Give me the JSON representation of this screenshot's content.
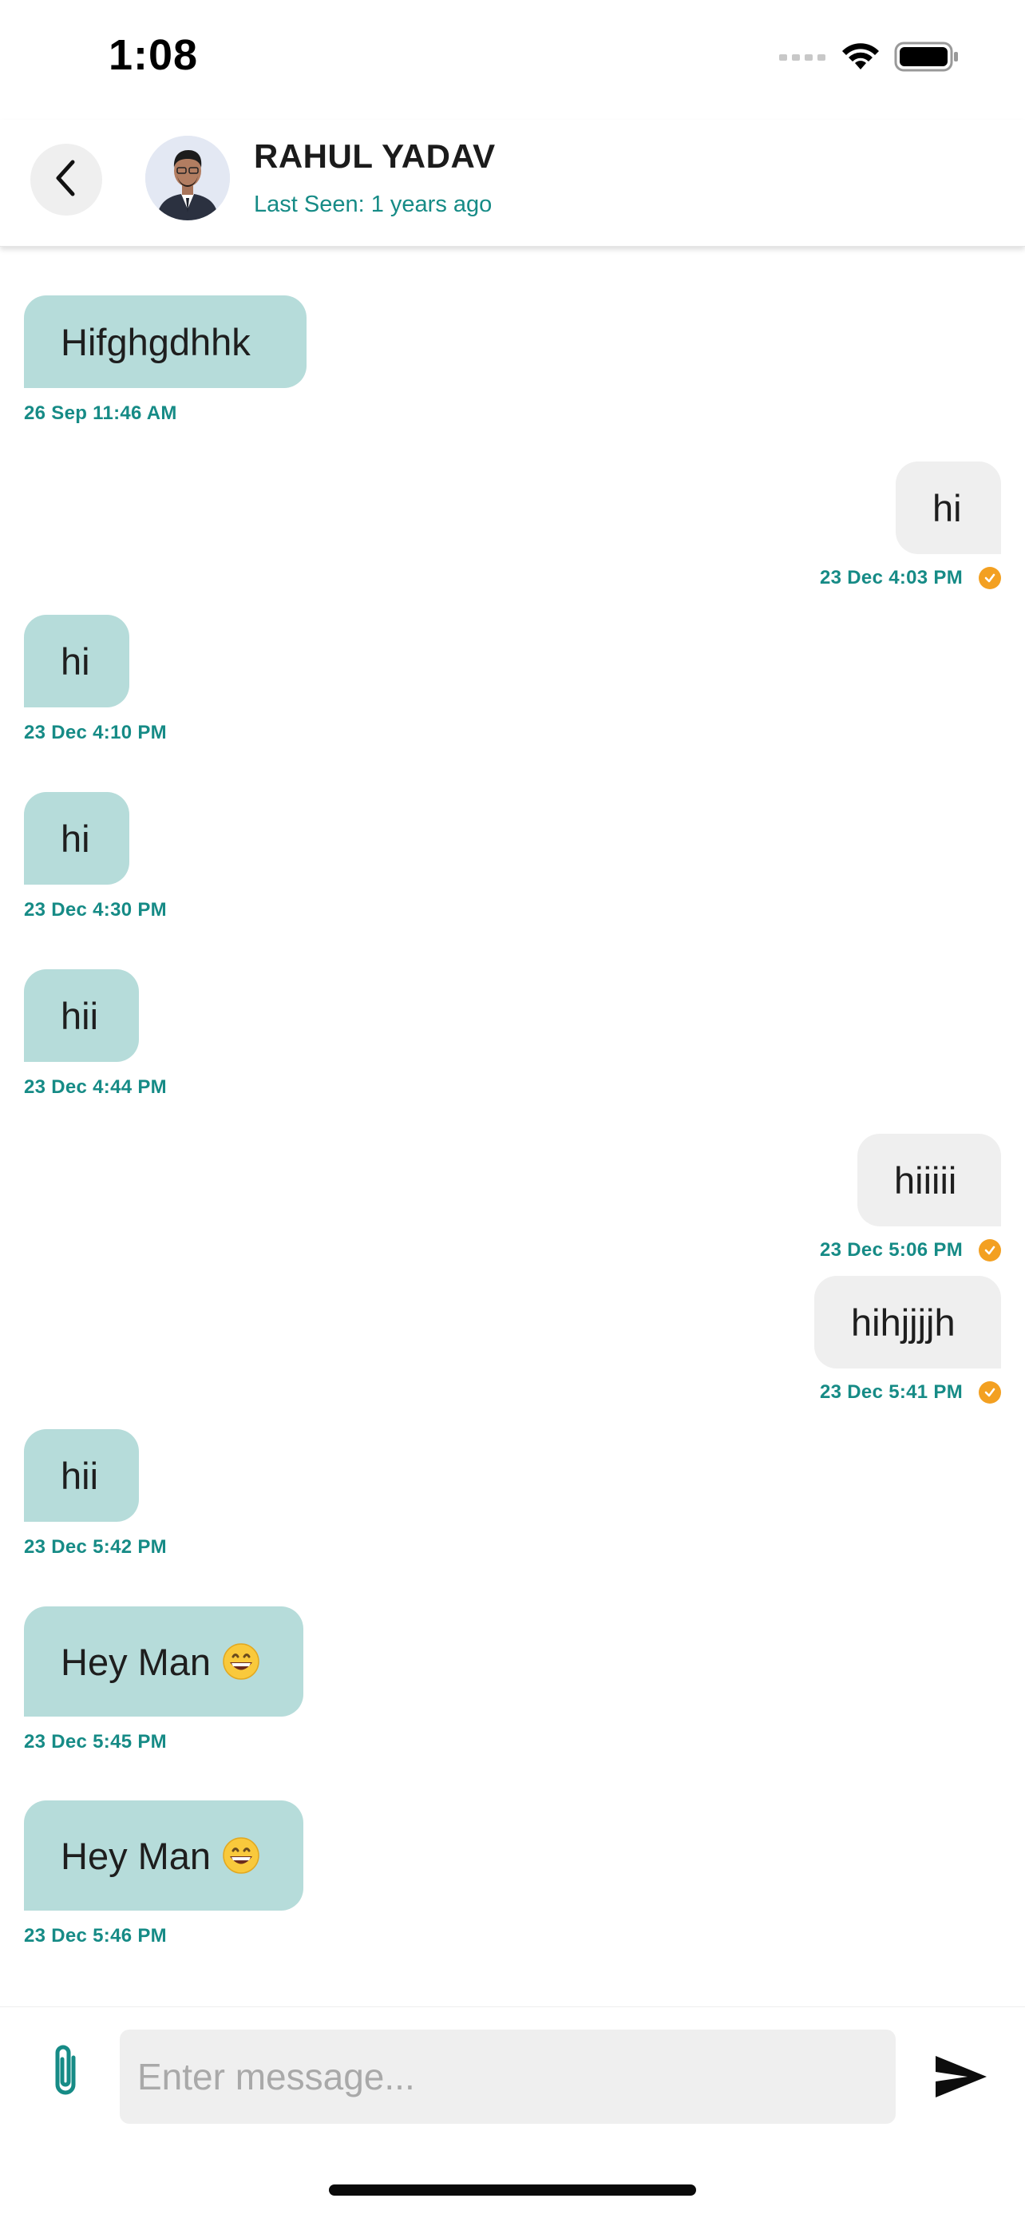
{
  "status_bar": {
    "time": "1:08",
    "icons": [
      "cellular-signal-icon",
      "wifi-icon",
      "battery-icon"
    ]
  },
  "header": {
    "back_icon": "chevron-left-icon",
    "contact_name": "RAHUL YADAV",
    "last_seen": "Last Seen: 1 years ago"
  },
  "messages": [
    {
      "direction": "incoming",
      "text": "Hifghgdhhk",
      "time": "26 Sep 11:46 AM"
    },
    {
      "direction": "outgoing",
      "text": "hi",
      "time": "23 Dec 4:03 PM",
      "read": true
    },
    {
      "direction": "incoming",
      "text": "hi",
      "time": "23 Dec 4:10 PM"
    },
    {
      "direction": "incoming",
      "text": "hi",
      "time": "23 Dec 4:30 PM"
    },
    {
      "direction": "incoming",
      "text": "hii",
      "time": "23 Dec 4:44 PM"
    },
    {
      "direction": "outgoing",
      "text": "hiiiii",
      "time": "23 Dec 5:06 PM",
      "read": true
    },
    {
      "direction": "outgoing",
      "text": "hihjjjjh",
      "time": "23 Dec 5:41 PM",
      "read": true
    },
    {
      "direction": "incoming",
      "text": "hii",
      "time": "23 Dec 5:42 PM"
    },
    {
      "direction": "incoming",
      "text": "Hey Man",
      "emoji": "grinning-face",
      "time": "23 Dec 5:45 PM"
    },
    {
      "direction": "incoming",
      "text": "Hey Man",
      "emoji": "grinning-face",
      "time": "23 Dec 5:46 PM"
    }
  ],
  "composer": {
    "placeholder": "Enter message...",
    "value": "",
    "attach_icon": "paperclip-icon",
    "send_icon": "send-icon"
  },
  "colors": {
    "incoming_bubble": "#b6dcda",
    "outgoing_bubble": "#efefef",
    "accent_teal": "#168b86",
    "read_receipt": "#f3a021"
  }
}
